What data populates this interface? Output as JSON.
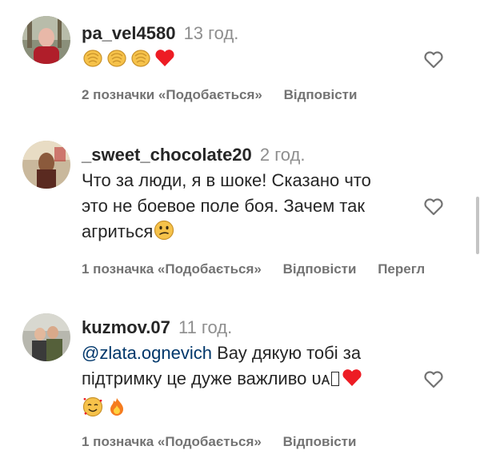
{
  "comments": [
    {
      "username": "pa_vel4580",
      "time": "13 год.",
      "text": "",
      "emojis": [
        "clapping-hands",
        "clapping-hands",
        "clapping-hands",
        "red-heart"
      ],
      "likes": "2 позначки «Подобається»",
      "reply": "Відповісти",
      "extra": ""
    },
    {
      "username": "_sweet_chocolate20",
      "time": "2 год.",
      "text_line1": "Что за люди, я в шоке! Сказано что",
      "text_line2": "это не боевое поле боя. Зачем так",
      "text_line3": "агриться",
      "emojis": [
        "confused-face"
      ],
      "likes": "1 позначка «Подобається»",
      "reply": "Відповісти",
      "extra": "Перегл"
    },
    {
      "username": "kuzmov.07",
      "time": "11 год.",
      "mention": "@zlata.ognevich",
      "text_line1": " Вау дякую тобі за",
      "text_line2": "підтримку це дуже важливо ",
      "flag_text": "ᴜᴀ",
      "emojis": [
        "red-heart",
        "smiling-face-with-hearts",
        "fire"
      ],
      "likes": "1 позначка «Подобається»",
      "reply": "Відповісти"
    }
  ],
  "colors": {
    "text": "#262626",
    "secondary": "#737373",
    "time": "#8e8e8e",
    "mention": "#00376b",
    "heart_red": "#ed1c24",
    "clap_yellow": "#f6c24a"
  }
}
